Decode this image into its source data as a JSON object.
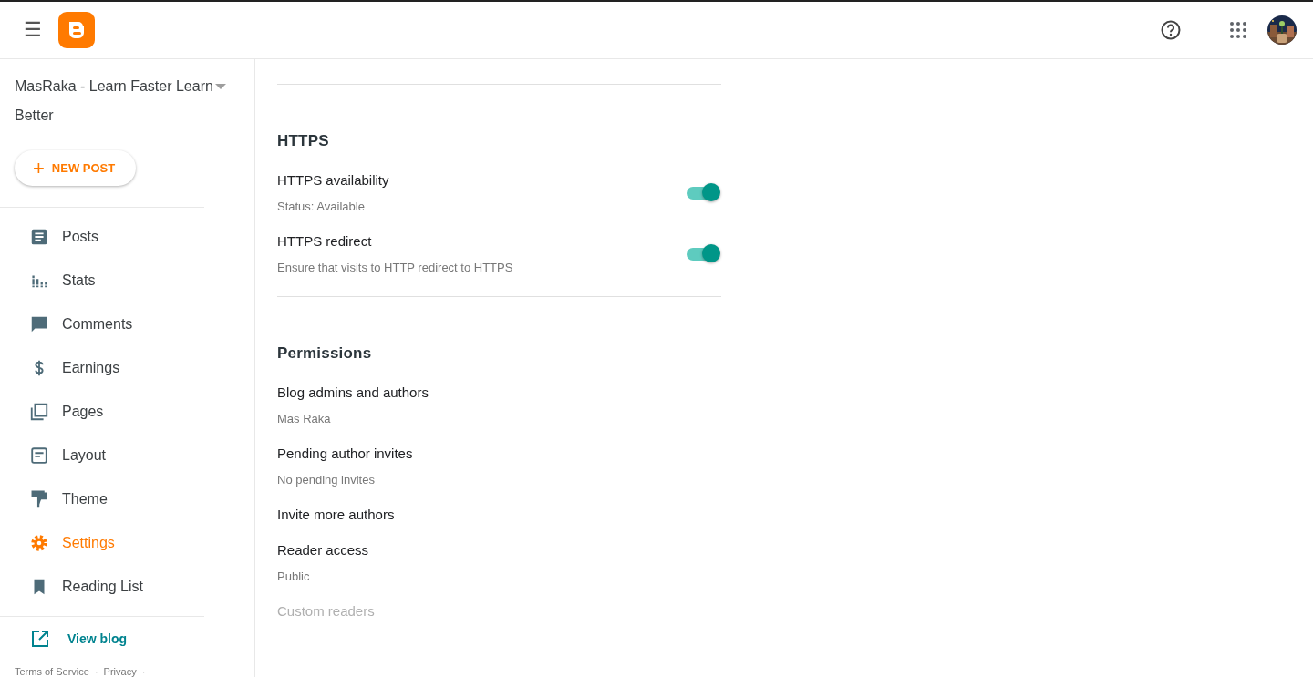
{
  "header": {
    "menu": "☰"
  },
  "sidebar": {
    "blog_title": "MasRaka - Learn Faster Learn Better",
    "new_post": {
      "icon": "+",
      "label": "NEW POST"
    },
    "items": [
      {
        "label": "Posts",
        "selected": false
      },
      {
        "label": "Stats",
        "selected": false
      },
      {
        "label": "Comments",
        "selected": false
      },
      {
        "label": "Earnings",
        "selected": false
      },
      {
        "label": "Pages",
        "selected": false
      },
      {
        "label": "Layout",
        "selected": false
      },
      {
        "label": "Theme",
        "selected": false
      },
      {
        "label": "Settings",
        "selected": true
      },
      {
        "label": "Reading List",
        "selected": false
      }
    ],
    "view_blog": "View blog",
    "footer_links": [
      "Terms of Service",
      "Privacy"
    ],
    "separator": "·"
  },
  "sections": [
    {
      "title": "HTTPS",
      "rows": [
        {
          "kind": "toggle",
          "title": "HTTPS availability",
          "subtitle": "Status: Available",
          "on": true
        },
        {
          "kind": "toggle",
          "title": "HTTPS redirect",
          "subtitle": "Ensure that visits to HTTP redirect to HTTPS",
          "on": true
        }
      ]
    },
    {
      "title": "Permissions",
      "rows": [
        {
          "kind": "text",
          "title": "Blog admins and authors",
          "subtitle": "Mas Raka",
          "disabled": false
        },
        {
          "kind": "text",
          "title": "Pending author invites",
          "subtitle": "No pending invites",
          "disabled": false
        },
        {
          "kind": "text",
          "title": "Invite more authors",
          "disabled": false
        },
        {
          "kind": "text",
          "title": "Reader access",
          "subtitle": "Public",
          "disabled": false
        },
        {
          "kind": "text",
          "title": "Custom readers",
          "disabled": true
        }
      ]
    }
  ]
}
